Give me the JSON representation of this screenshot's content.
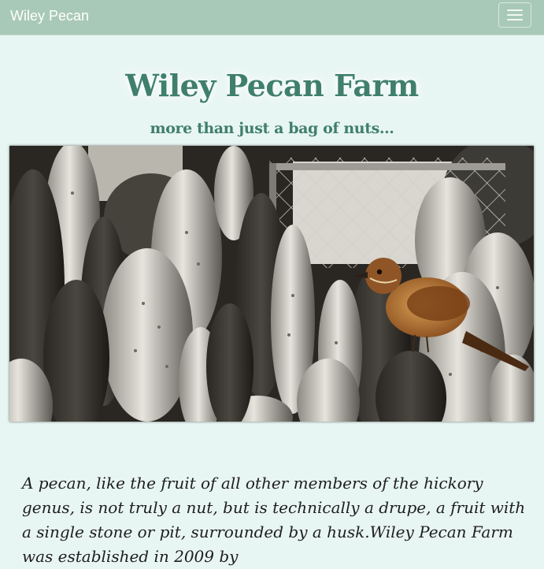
{
  "navbar": {
    "brand": "Wiley Pecan",
    "toggle_icon": "hamburger-menu-icon"
  },
  "header": {
    "title": "Wiley Pecan Farm",
    "tagline": "more than just a bag of nuts..."
  },
  "hero": {
    "image_subject": "bird-on-cactus-photo"
  },
  "intro": {
    "text": "A pecan, like the fruit of all other members of the hickory genus, is not truly a nut, but is technically a drupe, a fruit with a single stone or pit, surrounded by a husk.Wiley Pecan Farm was established in 2009 by"
  },
  "colors": {
    "navbar_bg": "#a9c9b8",
    "page_bg": "#e8f6f3",
    "heading": "#3f7f6b",
    "body_text": "#1e1e1e"
  }
}
